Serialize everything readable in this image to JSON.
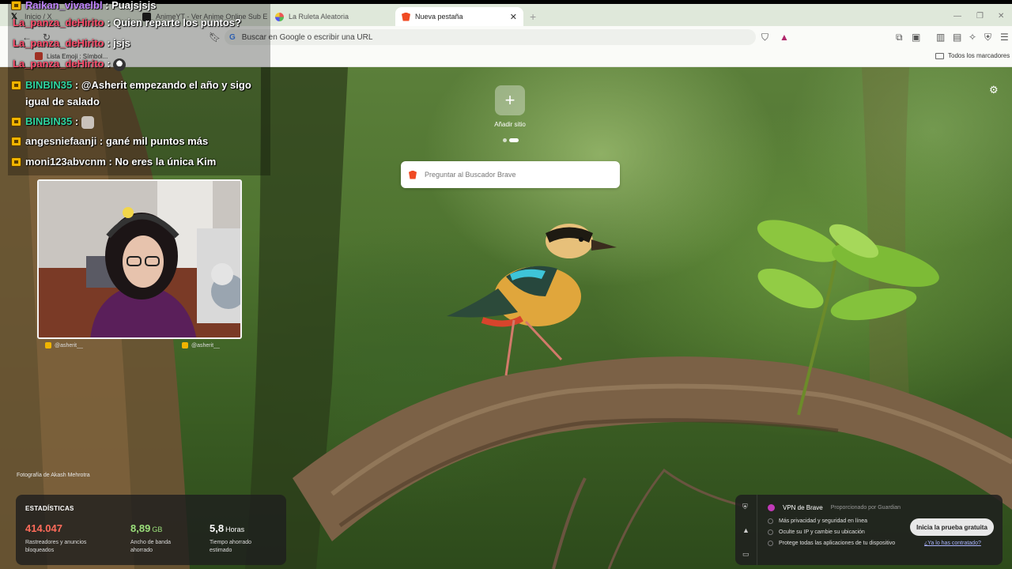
{
  "browser": {
    "tabs": [
      {
        "label": "Inicio / X",
        "icon": "x-logo-icon"
      },
      {
        "label": "AnimeYT - Ver Anime Online Sub Es...",
        "icon": "youtube-icon"
      },
      {
        "label": "La Ruleta Aleatoria",
        "icon": "wheel-icon"
      },
      {
        "label": "Nueva pestaña",
        "icon": "brave-lion-icon",
        "active": true
      }
    ],
    "address_placeholder": "Buscar en Google o escribir una URL",
    "bookmarks": [
      {
        "label": "Lista Emoji : Símbol...",
        "icon": "emoji-icon"
      }
    ],
    "all_bookmarks_label": "Todos los marcadores"
  },
  "newtab": {
    "add_site_label": "Añadir sitio",
    "search_placeholder": "Preguntar al Buscador Brave",
    "photo_credit": "Fotografía de Akash Mehrotra"
  },
  "stats": {
    "title": "ESTADÍSTICAS",
    "items": [
      {
        "value": "414.047",
        "unit": "",
        "desc": "Rastreadores y anuncios bloqueados",
        "color": "#ff6b5a"
      },
      {
        "value": "8,89",
        "unit": "GB",
        "desc": "Ancho de banda ahorrado",
        "color": "#9be07b"
      },
      {
        "value": "5,8",
        "unit": "Horas",
        "desc": "Tiempo ahorrado estimado",
        "color": "#ffffff"
      }
    ]
  },
  "vpn": {
    "title": "VPN de Brave",
    "provided": "Proporcionado por  Guardian",
    "bullets": [
      "Más privacidad y seguridad en línea",
      "Oculte su IP y cambie su ubicación",
      "Protege todas las aplicaciones de tu dispositivo"
    ],
    "cta": "Inicia la prueba gratuita",
    "link": "¿Ya lo has contratado?"
  },
  "chat": [
    {
      "user": "Raikan_vivaelbl",
      "color": "#c084ff",
      "msg": "Puajsjsjs"
    },
    {
      "user": "La_panza_deHirito",
      "color": "#ff4f6e",
      "msg": "Quien reparte los puntos?"
    },
    {
      "user": "La_panza_deHirito",
      "color": "#ff4f6e",
      "msg": "jsjs"
    },
    {
      "user": "La_panza_deHirito",
      "color": "#ff4f6e",
      "msg": "",
      "emote": true
    },
    {
      "user": "BINBIN35",
      "color": "#2fd6a0",
      "msg": "@Asherit empezando el año y sigo igual de salado"
    },
    {
      "user": "BINBIN35",
      "color": "#2fd6a0",
      "msg": "",
      "emote": true
    },
    {
      "user": "angesniefaanji",
      "color": "#f2f2f2",
      "msg": "gané mil puntos más"
    },
    {
      "user": "moni123abvcnm",
      "color": "#f2f2f2",
      "msg": "No eres la única Kim"
    }
  ],
  "cam_social": [
    "@asherit__",
    "@asherit__"
  ]
}
